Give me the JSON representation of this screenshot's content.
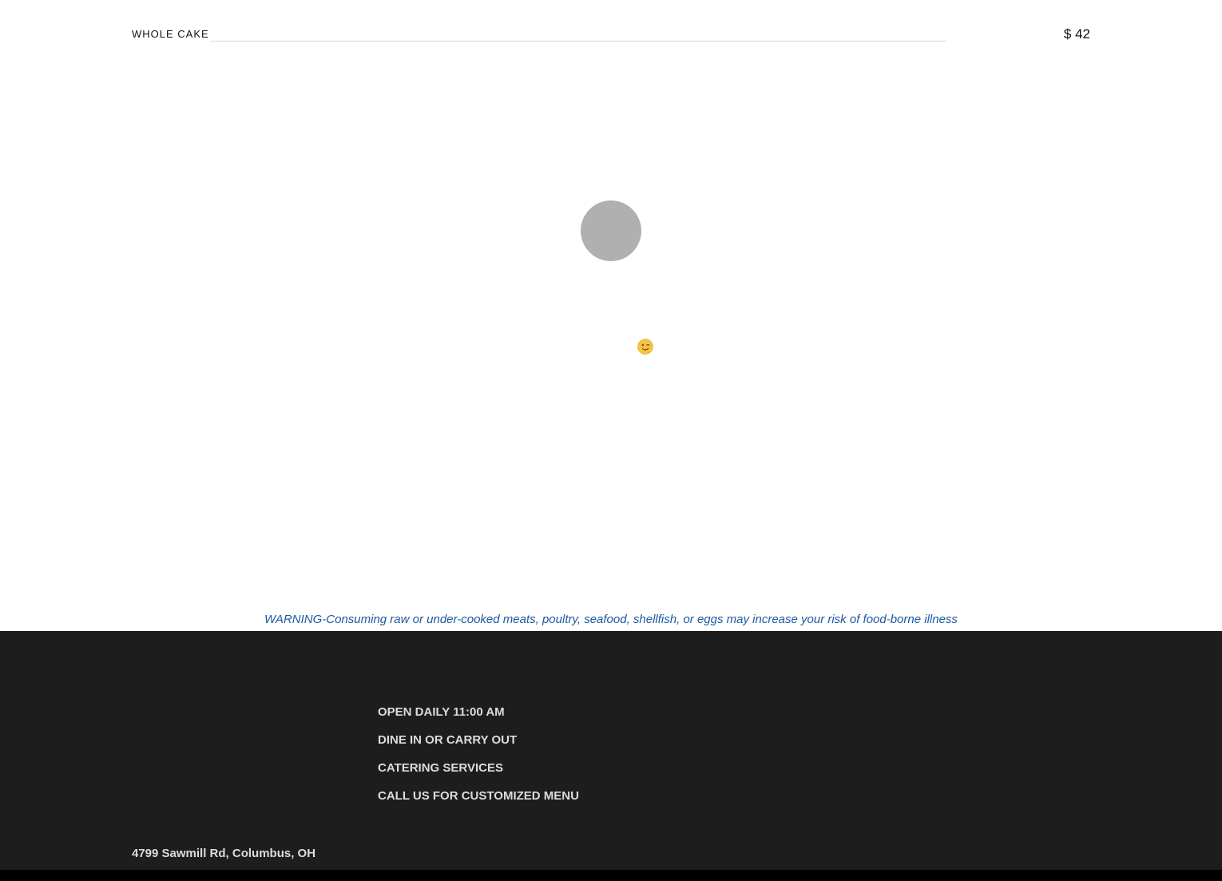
{
  "menu": {
    "item_name": "WHOLE CAKE",
    "item_price": "$ 42"
  },
  "icons": {
    "loader": "loading-circle",
    "emoji": "wink-emoji"
  },
  "warning": {
    "text": "WARNING-Consuming raw or under-cooked meats, poultry, seafood, shellfish, or eggs may increase your risk of food-borne illness",
    "color": "#1c5aa0"
  },
  "footer": {
    "items": [
      "OPEN DAILY 11:00 AM",
      "DINE IN OR CARRY OUT",
      "CATERING SERVICES",
      "CALL US FOR CUSTOMIZED MENU"
    ],
    "address": "4799 Sawmill Rd, Columbus, OH",
    "background": "#1d1d1d"
  }
}
